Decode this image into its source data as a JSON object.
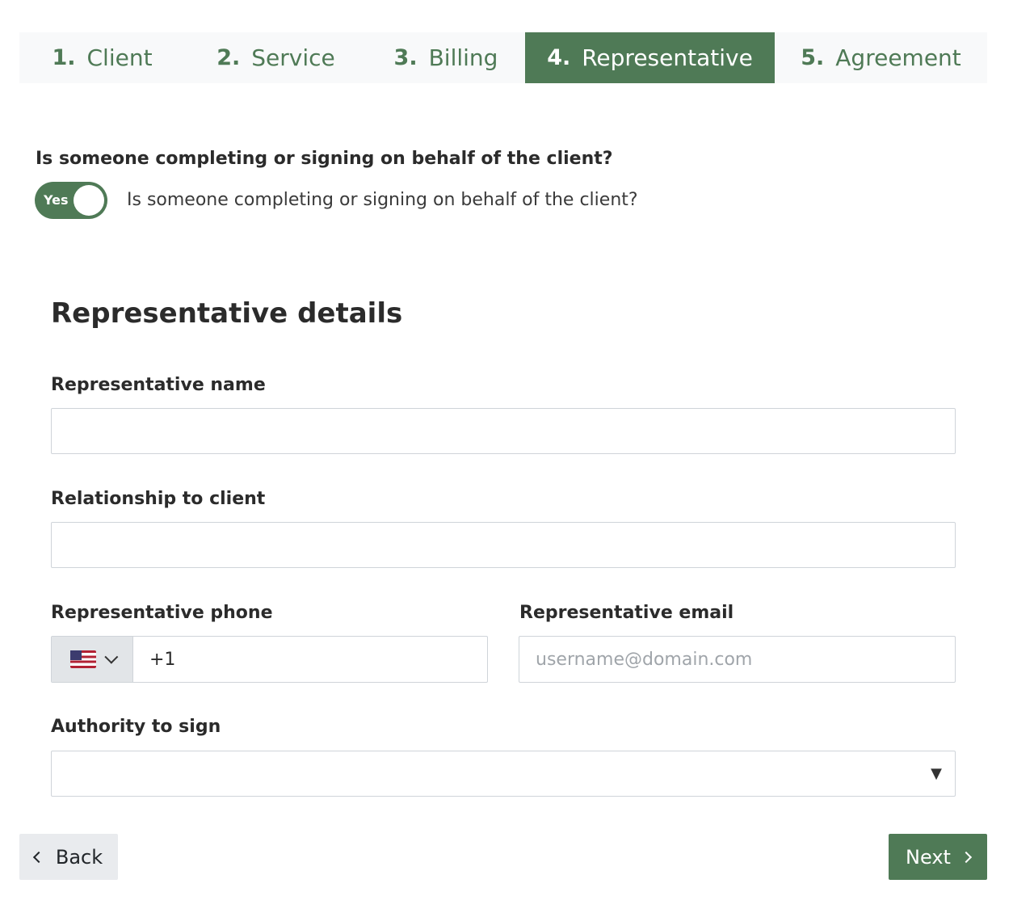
{
  "stepper": {
    "steps": [
      {
        "num": "1.",
        "label": "Client"
      },
      {
        "num": "2.",
        "label": "Service"
      },
      {
        "num": "3.",
        "label": "Billing"
      },
      {
        "num": "4.",
        "label": "Representative"
      },
      {
        "num": "5.",
        "label": "Agreement"
      }
    ],
    "active_step": 4
  },
  "question": {
    "label": "Is someone completing or signing on behalf of the client?",
    "toggle_state_label": "Yes",
    "toggle_text": "Is someone completing or signing on behalf of the client?"
  },
  "section": {
    "title": "Representative details"
  },
  "fields": {
    "name": {
      "label": "Representative name",
      "value": ""
    },
    "relationship": {
      "label": "Relationship to client",
      "value": ""
    },
    "phone": {
      "label": "Representative phone",
      "value": "+1",
      "country_icon": "us-flag-icon"
    },
    "email": {
      "label": "Representative email",
      "value": "",
      "placeholder": "username@domain.com"
    },
    "authority": {
      "label": "Authority to sign",
      "value": ""
    }
  },
  "nav": {
    "back_label": "Back",
    "next_label": "Next"
  },
  "colors": {
    "accent": "#4f7a56",
    "stepper_bg": "#f8f9fa",
    "back_bg": "#e9ebee"
  }
}
